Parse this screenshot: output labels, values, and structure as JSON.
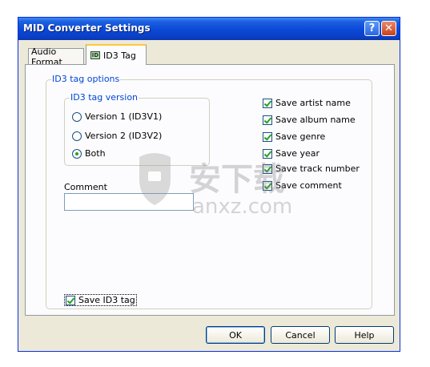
{
  "window": {
    "title": "MID Converter Settings",
    "help_label": "?",
    "close_label": "✕"
  },
  "tabs": [
    {
      "label": "Audio Format",
      "selected": false
    },
    {
      "label": "ID3 Tag",
      "selected": true,
      "icon_label": "ID"
    }
  ],
  "id3_options": {
    "legend": "ID3 tag options",
    "version_group": {
      "legend": "ID3 tag version",
      "options": [
        {
          "label": "Version 1 (ID3V1)",
          "selected": false
        },
        {
          "label": "Version 2 (ID3V2)",
          "selected": false
        },
        {
          "label": "Both",
          "selected": true
        }
      ]
    },
    "comment": {
      "label": "Comment",
      "value": ""
    },
    "checkboxes": [
      {
        "label": "Save artist name",
        "checked": true
      },
      {
        "label": "Save album name",
        "checked": true
      },
      {
        "label": "Save genre",
        "checked": true
      },
      {
        "label": "Save year",
        "checked": true
      },
      {
        "label": "Save track number",
        "checked": true
      },
      {
        "label": "Save comment",
        "checked": true
      }
    ],
    "save_id3": {
      "label": "Save ID3 tag",
      "checked": true
    }
  },
  "buttons": {
    "ok": "OK",
    "cancel": "Cancel",
    "help": "Help"
  },
  "watermark": {
    "text": "安下载",
    "subtext": "anxz.com"
  },
  "colors": {
    "title_bar": "#0a48d6",
    "group_legend": "#0046d5",
    "dialog_bg": "#ece9d8"
  }
}
